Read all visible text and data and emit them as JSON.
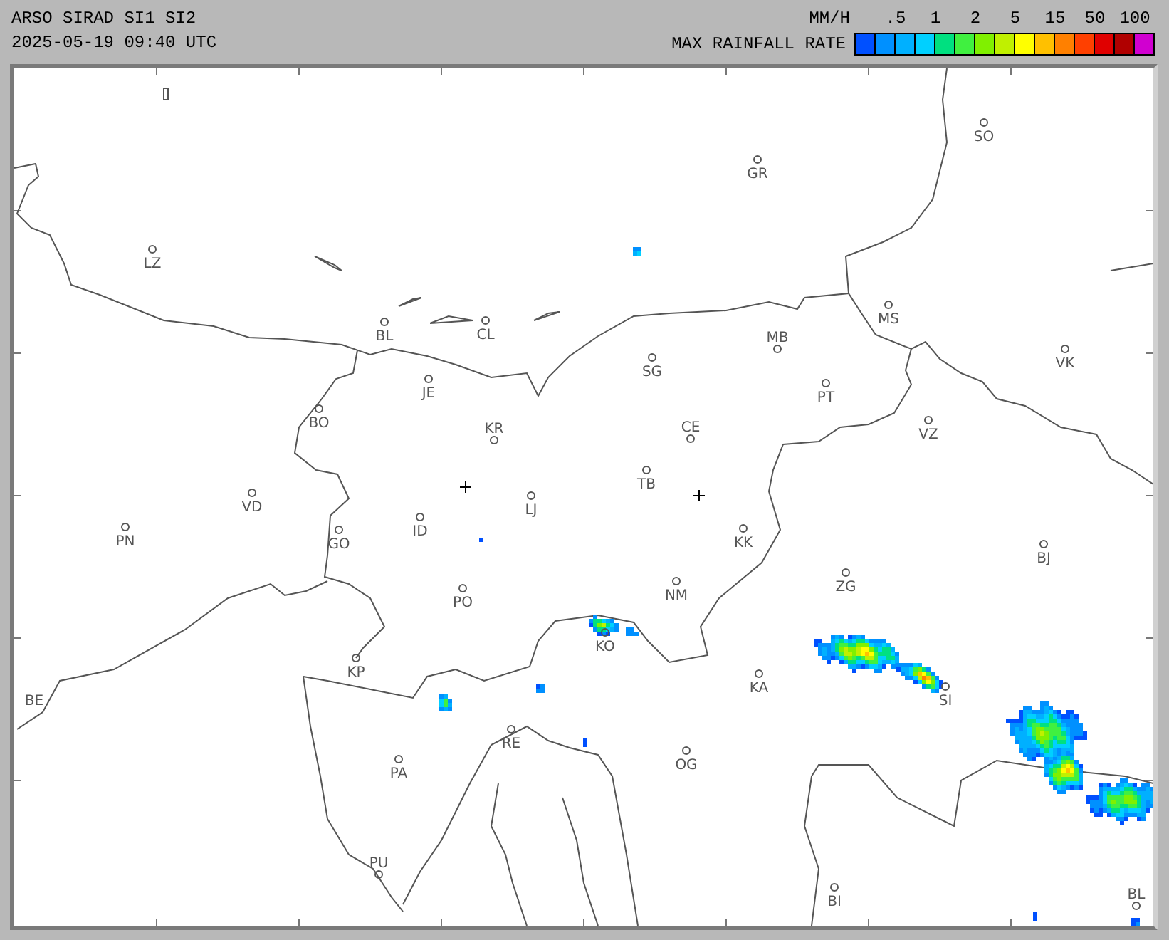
{
  "header": {
    "title": "ARSO SIRAD SI1 SI2",
    "timestamp": "2025-05-19 09:40 UTC",
    "unit": "MM/H",
    "legend_title": "MAX RAINFALL RATE",
    "legend_ticks": [
      ".5",
      "1",
      "2",
      "5",
      "15",
      "50",
      "100"
    ],
    "legend_colors": [
      {
        "color": "#0050ff"
      },
      {
        "color": "#0090ff"
      },
      {
        "color": "#00b0ff"
      },
      {
        "color": "#00d0ff"
      },
      {
        "color": "#00e080"
      },
      {
        "color": "#40f040"
      },
      {
        "color": "#80f000"
      },
      {
        "color": "#c0f000"
      },
      {
        "color": "#ffff00"
      },
      {
        "color": "#ffc000"
      },
      {
        "color": "#ff8000"
      },
      {
        "color": "#ff4000"
      },
      {
        "color": "#e00000"
      },
      {
        "color": "#b00000"
      },
      {
        "color": "#d000d0"
      }
    ]
  },
  "map": {
    "places": [
      {
        "label": "GR"
      },
      {
        "label": "SO"
      },
      {
        "label": "LZ"
      },
      {
        "label": "BL"
      },
      {
        "label": "CL"
      },
      {
        "label": "JE"
      },
      {
        "label": "BO"
      },
      {
        "label": "KR"
      },
      {
        "label": "SG"
      },
      {
        "label": "MB"
      },
      {
        "label": "MS"
      },
      {
        "label": "PT"
      },
      {
        "label": "VK"
      },
      {
        "label": "CE"
      },
      {
        "label": "VZ"
      },
      {
        "label": "TB"
      },
      {
        "label": "LJ"
      },
      {
        "label": "VD"
      },
      {
        "label": "PN"
      },
      {
        "label": "GO"
      },
      {
        "label": "ID"
      },
      {
        "label": "KK"
      },
      {
        "label": "BJ"
      },
      {
        "label": "ZG"
      },
      {
        "label": "NM"
      },
      {
        "label": "PO"
      },
      {
        "label": "KO"
      },
      {
        "label": "KA"
      },
      {
        "label": "KP"
      },
      {
        "label": "BE"
      },
      {
        "label": "PA"
      },
      {
        "label": "RE"
      },
      {
        "label": "OG"
      },
      {
        "label": "SI"
      },
      {
        "label": "PU"
      },
      {
        "label": "BI"
      },
      {
        "label": "BL"
      }
    ]
  }
}
